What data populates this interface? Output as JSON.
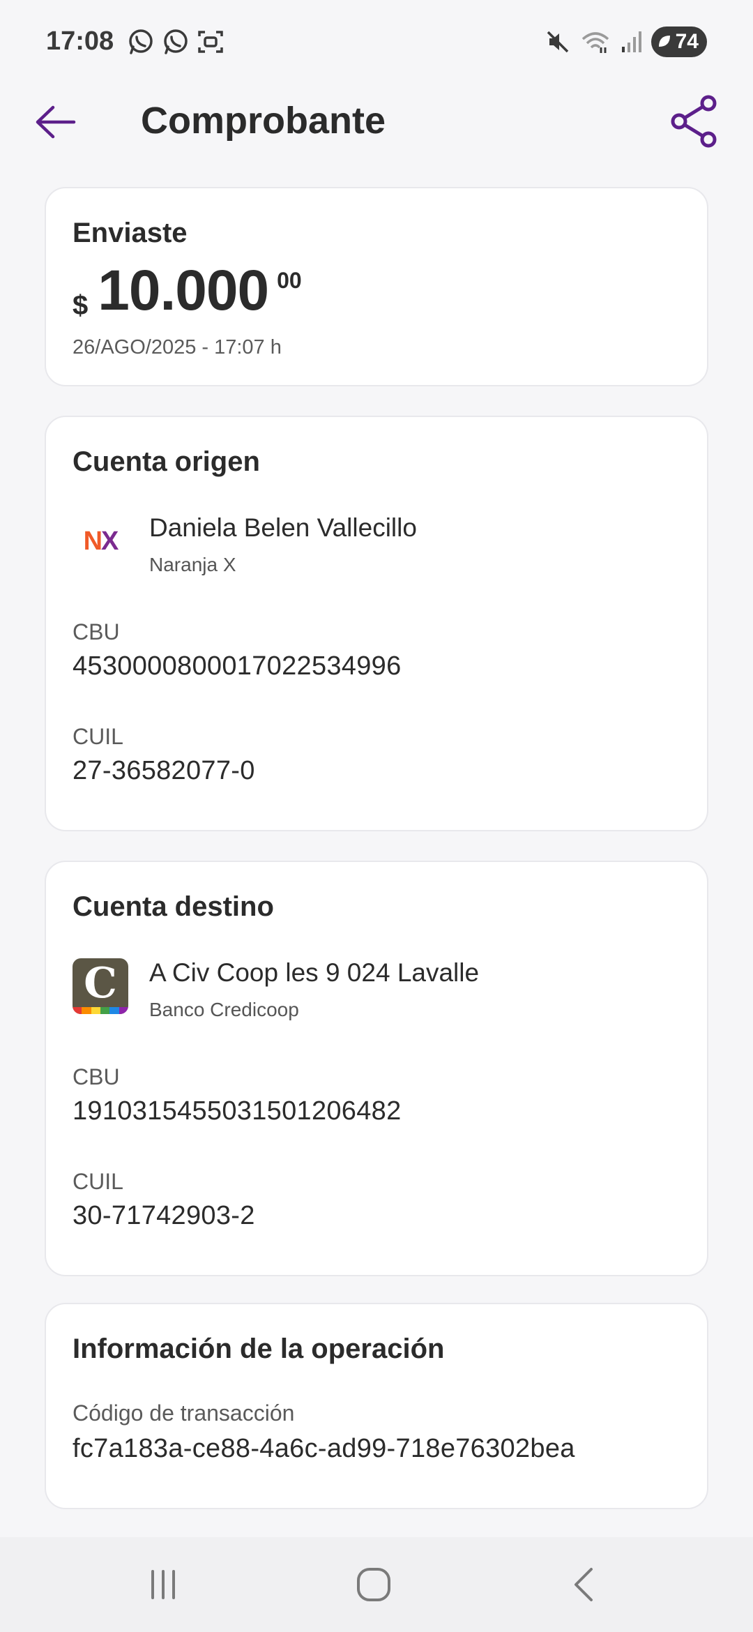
{
  "status_bar": {
    "time": "17:08",
    "battery_level": "74",
    "left_icons": [
      "whatsapp-icon",
      "whatsapp-icon",
      "screenshot-icon"
    ],
    "right_icons": [
      "mute-icon",
      "wifi-icon",
      "signal-icon",
      "battery-icon"
    ]
  },
  "header": {
    "title": "Comprobante",
    "back_icon": "arrow-left-icon",
    "share_icon": "share-icon"
  },
  "summary": {
    "label": "Enviaste",
    "currency": "$",
    "amount": "10.000",
    "cents": "00",
    "datetime": "26/AGO/2025 - 17:07 h"
  },
  "origin": {
    "title": "Cuenta origen",
    "logo_text_1": "N",
    "logo_text_2": "X",
    "name": "Daniela Belen Vallecillo",
    "bank": "Naranja X",
    "cbu_label": "CBU",
    "cbu": "4530000800017022534996",
    "cuil_label": "CUIL",
    "cuil": "27-36582077-0"
  },
  "destination": {
    "title": "Cuenta destino",
    "logo_letter": "C",
    "name": "A Civ Coop les 9 024 Lavalle",
    "bank": "Banco Credicoop",
    "cbu_label": "CBU",
    "cbu": "1910315455031501206482",
    "cuil_label": "CUIL",
    "cuil": "30-71742903-2"
  },
  "operation": {
    "title": "Información de la operación",
    "code_label": "Código de transacción",
    "code": "fc7a183a-ce88-4a6c-ad99-718e76302bea"
  },
  "colors": {
    "accent": "#5c1f8a",
    "naranja_orange": "#f05a28",
    "naranja_purple": "#7b2b8f",
    "credicoop_brown": "#5b5645"
  },
  "nav_bar": {
    "icons": [
      "recent-apps-icon",
      "home-icon",
      "back-icon"
    ]
  }
}
